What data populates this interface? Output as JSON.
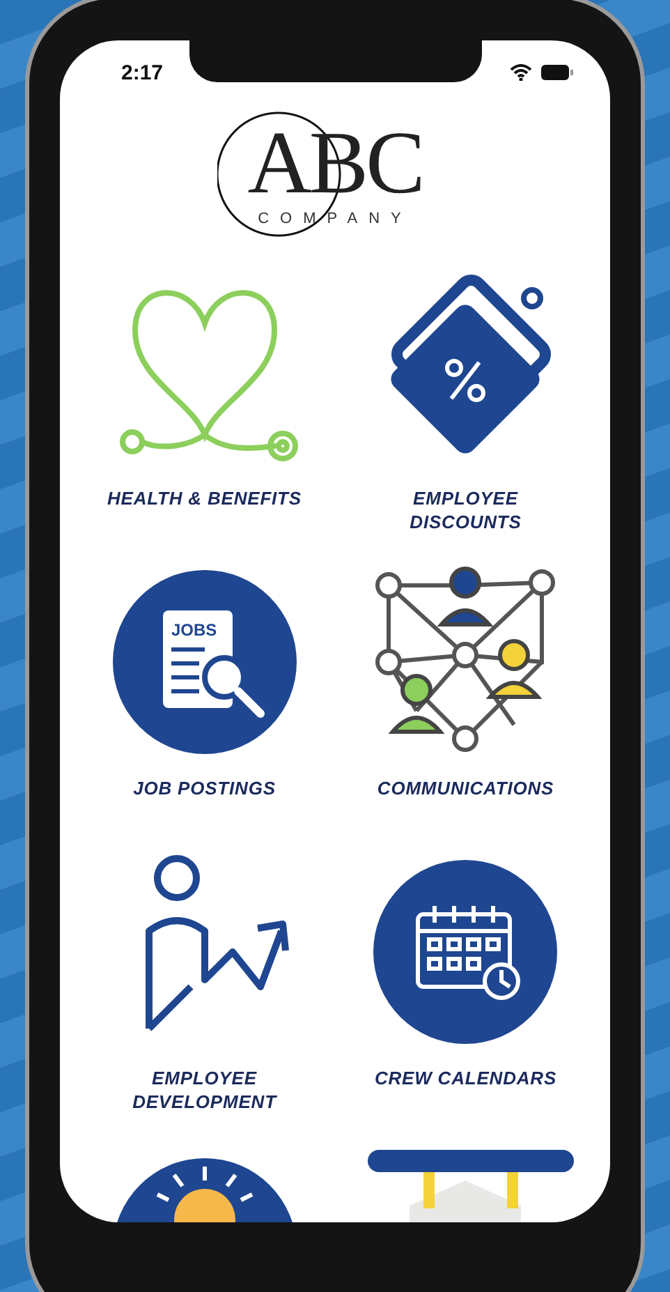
{
  "status_bar": {
    "time": "2:17"
  },
  "logo": {
    "letters": "ABC",
    "subtitle": "COMPANY"
  },
  "tiles": [
    {
      "kind": "health",
      "label": "HEALTH & BENEFITS"
    },
    {
      "kind": "discounts",
      "label": "EMPLOYEE\nDISCOUNTS"
    },
    {
      "kind": "jobs",
      "label": "JOB POSTINGS",
      "icon_text": "JOBS"
    },
    {
      "kind": "network",
      "label": "COMMUNICATIONS"
    },
    {
      "kind": "growth",
      "label": "EMPLOYEE\nDEVELOPMENT"
    },
    {
      "kind": "calendar",
      "label": "CREW CALENDARS"
    },
    {
      "kind": "idea"
    },
    {
      "kind": "sign"
    }
  ]
}
